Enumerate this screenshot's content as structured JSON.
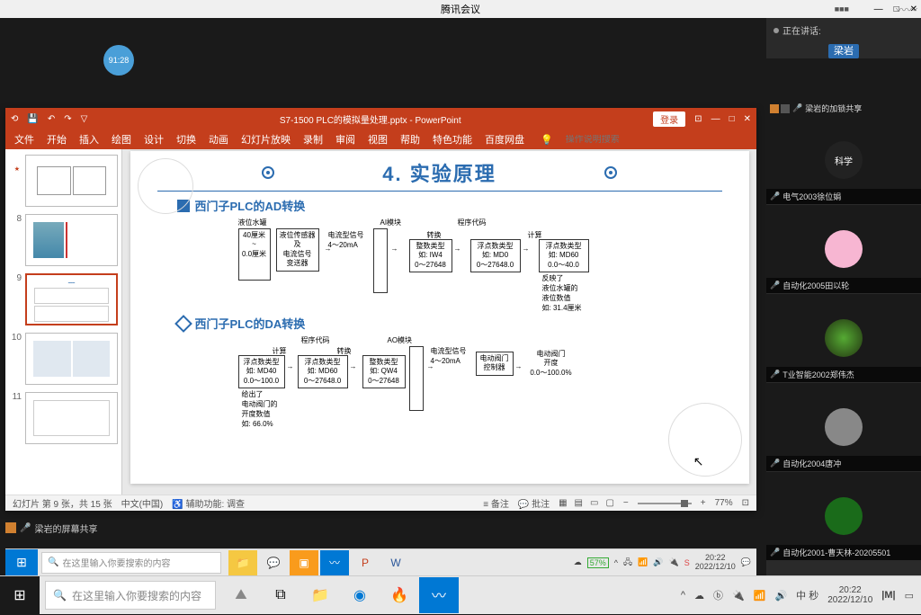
{
  "meeting": {
    "app_title": "腾讯会议",
    "timer": "91:28",
    "speaking_label": "正在讲话:",
    "speakers": "",
    "spotlight_name": "梁岩",
    "presenter_label": "梁岩的加锁共享",
    "sharing_footer": "梁岩的屏幕共享",
    "participants": [
      {
        "name": "科学",
        "avatar_bg": "#222",
        "avatar_text": "科学"
      },
      {
        "name": "电气2003徐位娟",
        "avatar_bg": "#333"
      },
      {
        "name": "自动化2005田以轮",
        "avatar_bg": "#f7b6d2"
      },
      {
        "name": "T业智能2002郑伟杰",
        "avatar_bg": "#3a2a1a"
      },
      {
        "name": "自动化2004唐冲",
        "avatar_bg": "#666"
      },
      {
        "name": "自动化2001-曹天林-20205501",
        "avatar_bg": "#1a6b1a"
      }
    ]
  },
  "ppt": {
    "doc_title": "S7-1500 PLC的模拟量处理.pptx - PowerPoint",
    "login": "登录",
    "tabs": [
      "文件",
      "开始",
      "插入",
      "绘图",
      "设计",
      "切换",
      "动画",
      "幻灯片放映",
      "录制",
      "审阅",
      "视图",
      "帮助",
      "特色功能",
      "百度网盘"
    ],
    "tell_me": "操作说明搜索",
    "status": {
      "slide": "幻灯片 第 9 张，共 15 张",
      "lang": "中文(中国)",
      "access": "辅助功能: 调查",
      "notes": "备注",
      "comments": "批注",
      "zoom": "77%"
    },
    "thumbs": [
      {
        "n": "8"
      },
      {
        "n": "9",
        "sel": true
      },
      {
        "n": "10"
      },
      {
        "n": "11"
      }
    ],
    "top_thumb": "",
    "slide": {
      "title": "4. 实验原理",
      "sec1": "西门子PLC的AD转换",
      "sec2": "西门子PLC的DA转换",
      "d1": {
        "tank": "液位水罐",
        "tank_vals": "40厘米\n~\n0.0厘米",
        "sensor": "液位传感器\n及\n电流信号\n变送器",
        "signal": "电流型信号\n4～20mA",
        "ai": "AI模块",
        "conv": "转换",
        "int": "整数类型\n如: IW4\n0～27648",
        "code": "程序代码",
        "calc": "计算",
        "float1": "浮点数类型\n如: MD0\n0～27648.0",
        "float2": "浮点数类型\n如: MD60\n0.0～40.0",
        "note": "反映了\n液位水罐的\n液位数值\n如: 31.4厘米"
      },
      "d2": {
        "code": "程序代码",
        "calc": "计算",
        "conv": "转换",
        "f1": "浮点数类型\n如: MD40\n0.0～100.0",
        "f2": "浮点数类型\n如: MD60\n0～27648.0",
        "i1": "整数类型\n如: QW4\n0～27648",
        "note": "给出了\n电动阀门的\n开度数值\n如: 66.0%",
        "ao": "AO模块",
        "sig": "电流型信号\n4～20mA",
        "ctrl": "电动阀门\n控制器",
        "valve": "电动阀门\n开度\n0.0～100.0%"
      }
    }
  },
  "inner_taskbar": {
    "search_placeholder": "在这里输入你要搜索的内容",
    "battery": "57%",
    "time": "20:22",
    "date": "2022/12/10"
  },
  "outer_taskbar": {
    "search_placeholder": "在这里输入你要搜索的内容",
    "ime": "中 秒",
    "time": "20:22",
    "date": "2022/12/10"
  }
}
